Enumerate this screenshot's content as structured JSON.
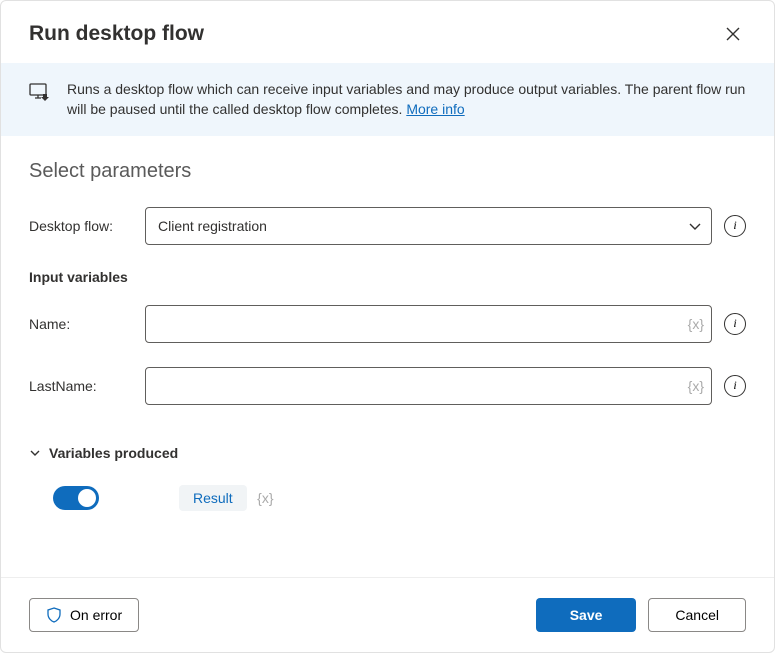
{
  "header": {
    "title": "Run desktop flow"
  },
  "banner": {
    "text": "Runs a desktop flow which can receive input variables and may produce output variables. The parent flow run will be paused until the called desktop flow completes. ",
    "link": "More info"
  },
  "params": {
    "section_title": "Select parameters",
    "desktop_flow_label": "Desktop flow:",
    "desktop_flow_value": "Client registration",
    "input_vars_title": "Input variables",
    "inputs": [
      {
        "label": "Name:",
        "value": ""
      },
      {
        "label": "LastName:",
        "value": ""
      }
    ],
    "vars_produced_title": "Variables produced",
    "result_var": "Result"
  },
  "footer": {
    "on_error": "On error",
    "save": "Save",
    "cancel": "Cancel"
  }
}
